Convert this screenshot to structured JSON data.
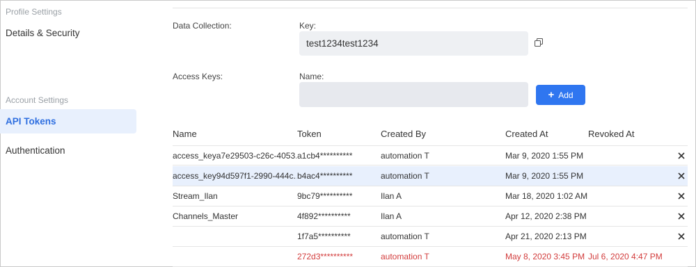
{
  "sidebar": {
    "profile_section": "Profile Settings",
    "details_item": "Details & Security",
    "account_section": "Account Settings",
    "api_tokens_item": "API Tokens",
    "authentication_item": "Authentication"
  },
  "data_collection": {
    "label": "Data Collection:",
    "key_label": "Key:",
    "key_value": "test1234test1234"
  },
  "access_keys": {
    "label": "Access Keys:",
    "name_label": "Name:",
    "name_value": "",
    "add_label": "Add"
  },
  "table": {
    "headers": {
      "name": "Name",
      "token": "Token",
      "created_by": "Created By",
      "created_at": "Created At",
      "revoked_at": "Revoked At"
    },
    "rows": [
      {
        "name": "access_keya7e29503-c26c-4053...",
        "token": "a1cb4**********",
        "created_by": "automation T",
        "created_at": "Mar 9, 2020 1:55 PM",
        "revoked_at": ""
      },
      {
        "name": "access_key94d597f1-2990-444c...",
        "token": "b4ac4**********",
        "created_by": "automation T",
        "created_at": "Mar 9, 2020 1:55 PM",
        "revoked_at": ""
      },
      {
        "name": "Stream_Ilan",
        "token": "9bc79**********",
        "created_by": "Ilan A",
        "created_at": "Mar 18, 2020 1:02 AM",
        "revoked_at": ""
      },
      {
        "name": "Channels_Master",
        "token": "4f892**********",
        "created_by": "Ilan A",
        "created_at": "Apr 12, 2020 2:38 PM",
        "revoked_at": ""
      },
      {
        "name": "",
        "token": "1f7a5**********",
        "created_by": "automation T",
        "created_at": "Apr 21, 2020 2:13 PM",
        "revoked_at": ""
      },
      {
        "name": "",
        "token": "272d3**********",
        "created_by": "automation T",
        "created_at": "May 8, 2020 3:45 PM",
        "revoked_at": "Jul 6, 2020 4:47 PM"
      }
    ]
  },
  "colors": {
    "accent": "#2f76f0",
    "active_bg": "#e8f0fd",
    "revoked": "#d23b3b"
  },
  "icons": {
    "copy": "copy-icon",
    "add": "plus-icon",
    "revoke": "close-icon"
  }
}
